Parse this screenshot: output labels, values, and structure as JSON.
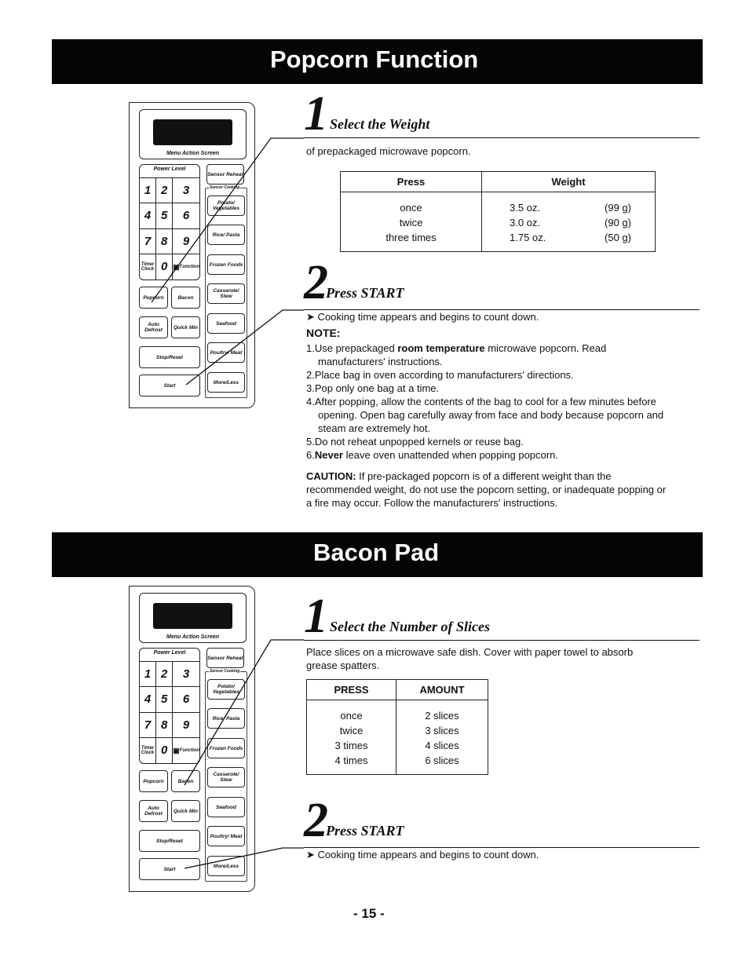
{
  "sections": [
    {
      "title": "Popcorn Function",
      "step1": {
        "number": "1",
        "title": "Select the Weight",
        "text": "of prepackaged microwave popcorn.",
        "table": {
          "headers": [
            "Press",
            "Weight"
          ],
          "rows": [
            {
              "press": "once",
              "oz": "3.5 oz.",
              "g": "(99 g)"
            },
            {
              "press": "twice",
              "oz": "3.0 oz.",
              "g": "(90 g)"
            },
            {
              "press": "three times",
              "oz": "1.75 oz.",
              "g": "(50 g)"
            }
          ]
        }
      },
      "step2": {
        "number": "2",
        "title": "Press START",
        "result": "➤ Cooking time appears and begins to count down.",
        "note_label": "NOTE:",
        "notes": [
          {
            "pre": "1.Use prepackaged ",
            "bold": "room temperature",
            "post": " microwave popcorn.  Read",
            "cont": "manufacturers' instructions."
          },
          {
            "pre": "2.Place bag in oven according to manufacturers' directions.",
            "bold": "",
            "post": "",
            "cont": ""
          },
          {
            "pre": "3.Pop only one bag at a time.",
            "bold": "",
            "post": "",
            "cont": ""
          },
          {
            "pre": "4.After popping, allow the contents of the bag to cool for a few minutes before",
            "bold": "",
            "post": "",
            "cont": "opening.  Open bag carefully away from face and body because popcorn and",
            "cont2": "steam are extremely hot."
          },
          {
            "pre": "5.Do not reheat unpopped kernels or reuse bag.",
            "bold": "",
            "post": "",
            "cont": ""
          },
          {
            "pre": "6.",
            "bold": "Never",
            "post": " leave oven unattended when popping popcorn.",
            "cont": ""
          }
        ],
        "caution_label": "CAUTION:",
        "caution_lines": [
          " If pre-packaged popcorn is of a different weight than the",
          "recommended weight, do not use the popcorn setting, or inadequate popping or",
          "a fire may occur.  Follow the manufacturers' instructions."
        ]
      }
    },
    {
      "title": "Bacon Pad",
      "step1": {
        "number": "1",
        "title": "Select the Number of Slices",
        "text_lines": [
          "Place slices on a microwave safe dish.  Cover with paper towel to absorb",
          "grease spatters."
        ],
        "table": {
          "headers": [
            "PRESS",
            "AMOUNT"
          ],
          "rows": [
            {
              "press": "once",
              "amount": "2 slices"
            },
            {
              "press": "twice",
              "amount": "3 slices"
            },
            {
              "press": "3 times",
              "amount": "4 slices"
            },
            {
              "press": "4 times",
              "amount": "6 slices"
            }
          ]
        }
      },
      "step2": {
        "number": "2",
        "title": "Press START",
        "result": "➤ Cooking time appears and begins to count down."
      }
    }
  ],
  "keypad": {
    "screen_label": "Menu Action Screen",
    "power_level": "Power Level",
    "digits": [
      "1",
      "2",
      "3",
      "4",
      "5",
      "6",
      "7",
      "8",
      "9"
    ],
    "timer_clock": "Timer Clock",
    "zero": "0",
    "function": "Function",
    "function_icon": "clock-function-icon",
    "popcorn": "Popcorn",
    "bacon": "Bacon",
    "auto_defrost": "Auto Defrost",
    "quick_min": "Quick Min",
    "stop_reset": "Stop/Reset",
    "start": "Start",
    "sensor_reheat": "Sensor Reheat",
    "sensor_cooking": "Sensor Cooking",
    "potato": "Potato/ Vegetables",
    "rice": "Rice/ Pasta",
    "frozen": "Frozen Foods",
    "casserole": "Casserole/ Stew",
    "seafood": "Seafood",
    "poultry": "Poultry/ Meat",
    "more_less": "More/Less"
  },
  "page_number": "- 15 -"
}
